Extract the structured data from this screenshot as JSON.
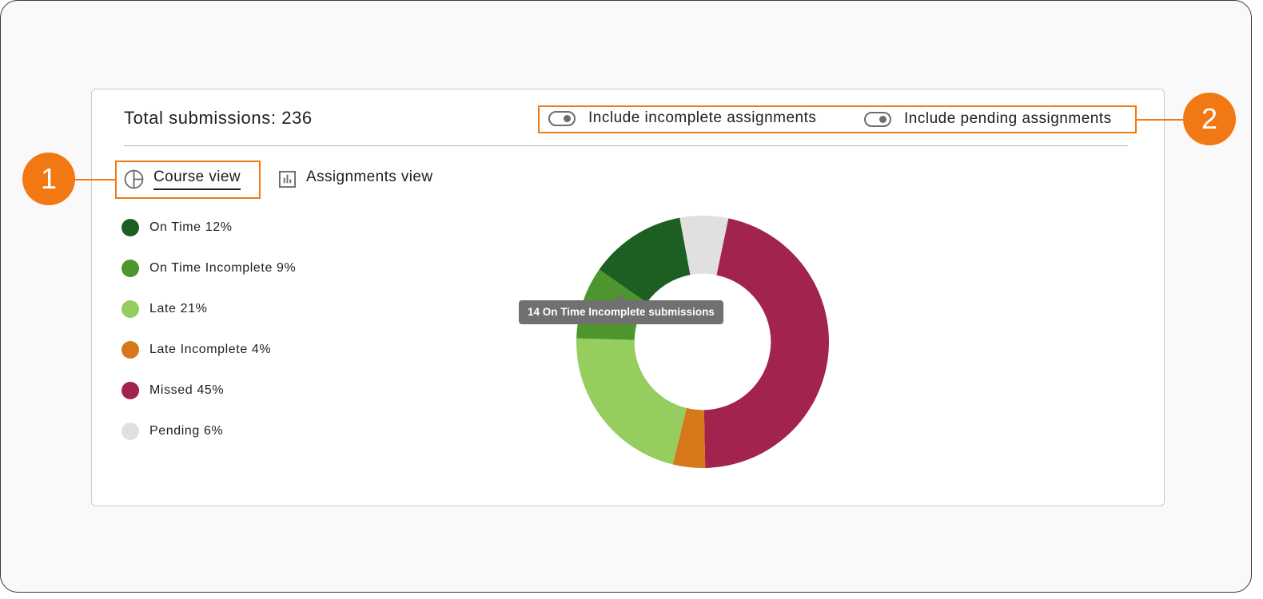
{
  "summary": {
    "total_label": "Total submissions: 236"
  },
  "toggles": [
    {
      "label": "Include incomplete assignments"
    },
    {
      "label": "Include pending assignments"
    }
  ],
  "views": {
    "course_label": "Course view",
    "assignments_label": "Assignments view",
    "active": "Course view"
  },
  "callouts": [
    "1",
    "2"
  ],
  "tooltip": {
    "text": "14 On Time Incomplete submissions"
  },
  "icons": [
    "pie-chart-icon",
    "bar-chart-icon",
    "toggle-switch-icon"
  ],
  "colors": {
    "on_time": "#1d5e22",
    "on_time_incomplete": "#4d952c",
    "late": "#95ce5e",
    "late_incomplete": "#d6771a",
    "missed": "#a2234e",
    "pending": "#e0e0e0",
    "accent": "#f27814"
  },
  "chart_data": {
    "type": "pie",
    "categories": [
      "On Time",
      "On Time Incomplete",
      "Late",
      "Late Incomplete",
      "Missed",
      "Pending"
    ],
    "values": [
      12,
      9,
      21,
      4,
      45,
      6
    ],
    "legend_labels": [
      "On Time 12%",
      "On Time Incomplete 9%",
      "Late 21%",
      "Late Incomplete 4%",
      "Missed 45%",
      "Pending 6%"
    ],
    "colors": [
      "#1d5e22",
      "#4d952c",
      "#95ce5e",
      "#d6771a",
      "#a2234e",
      "#e0e0e0"
    ],
    "hole": 0.54,
    "legend_position": "left",
    "title": "",
    "xlabel": "",
    "ylabel": ""
  }
}
